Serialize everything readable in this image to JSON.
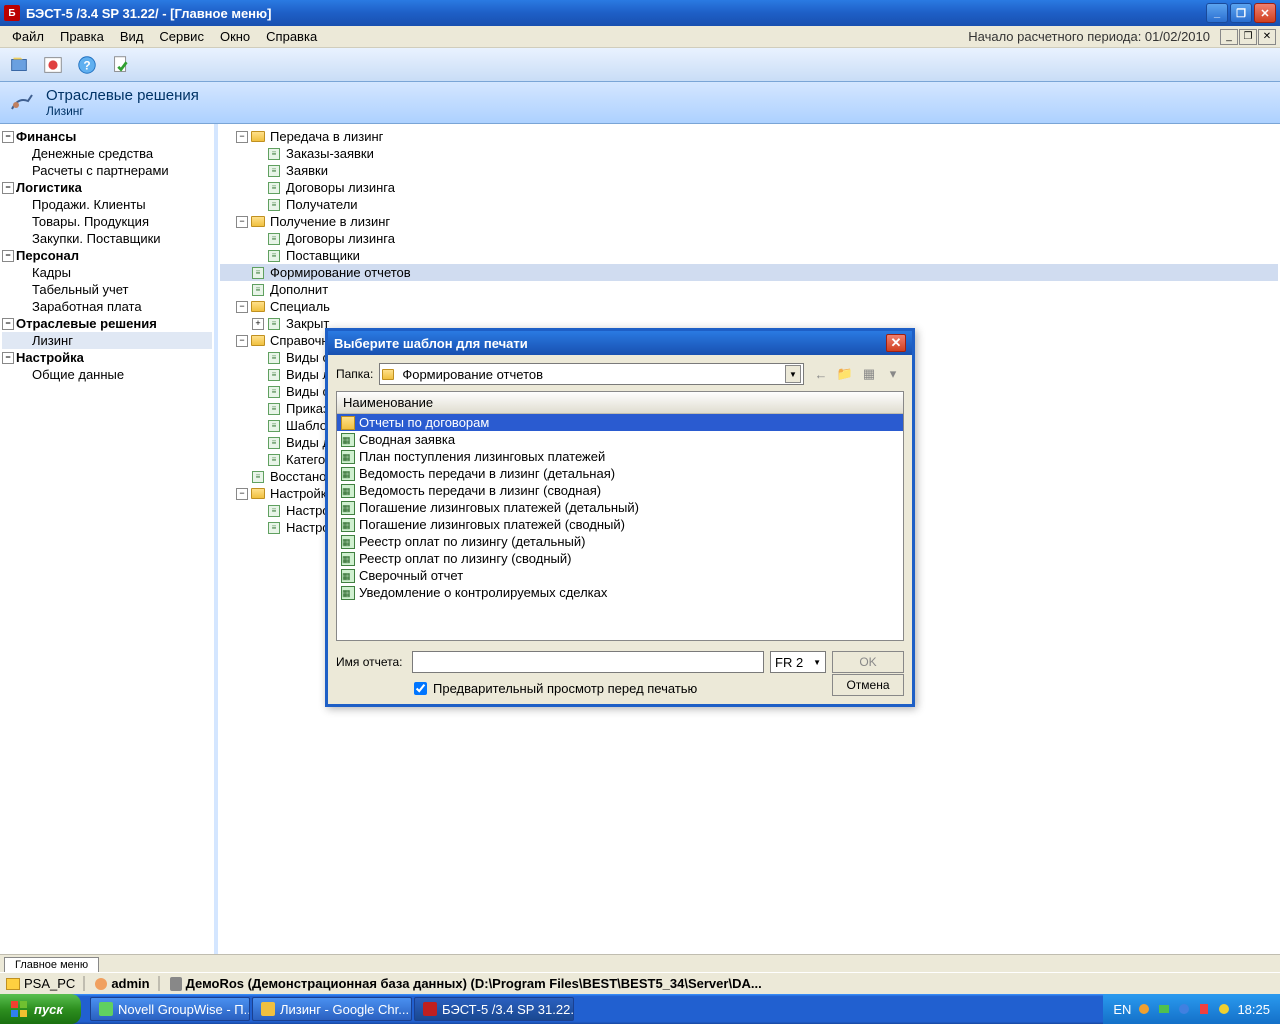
{
  "titlebar": {
    "text": "БЭСТ-5 /3.4 SP 31.22/ - [Главное меню]"
  },
  "menubar": {
    "items": [
      "Файл",
      "Правка",
      "Вид",
      "Сервис",
      "Окно",
      "Справка"
    ],
    "right": "Начало расчетного периода: 01/02/2010"
  },
  "header": {
    "main": "Отраслевые решения",
    "sub": "Лизинг"
  },
  "left_tree": [
    {
      "label": "Финансы",
      "bold": true,
      "exp": "-",
      "indent": 0
    },
    {
      "label": "Денежные средства",
      "indent": 1
    },
    {
      "label": "Расчеты с партнерами",
      "indent": 1
    },
    {
      "label": "Логистика",
      "bold": true,
      "exp": "-",
      "indent": 0
    },
    {
      "label": "Продажи. Клиенты",
      "indent": 1
    },
    {
      "label": "Товары. Продукция",
      "indent": 1
    },
    {
      "label": "Закупки. Поставщики",
      "indent": 1
    },
    {
      "label": "Персонал",
      "bold": true,
      "exp": "-",
      "indent": 0
    },
    {
      "label": "Кадры",
      "indent": 1
    },
    {
      "label": "Табельный учет",
      "indent": 1
    },
    {
      "label": "Заработная плата",
      "indent": 1
    },
    {
      "label": "Отраслевые решения",
      "bold": true,
      "exp": "-",
      "indent": 0
    },
    {
      "label": "Лизинг",
      "indent": 1,
      "selected": true
    },
    {
      "label": "Настройка",
      "bold": true,
      "exp": "-",
      "indent": 0
    },
    {
      "label": "Общие данные",
      "indent": 1
    }
  ],
  "right_tree": [
    {
      "label": "Передача в лизинг",
      "icon": "folder",
      "exp": "-",
      "indent": 0
    },
    {
      "label": "Заказы-заявки",
      "icon": "doc",
      "indent": 1
    },
    {
      "label": "Заявки",
      "icon": "doc",
      "indent": 1
    },
    {
      "label": "Договоры лизинга",
      "icon": "doc",
      "indent": 1
    },
    {
      "label": "Получатели",
      "icon": "doc",
      "indent": 1
    },
    {
      "label": "Получение в лизинг",
      "icon": "folder",
      "exp": "-",
      "indent": 0
    },
    {
      "label": "Договоры лизинга",
      "icon": "doc",
      "indent": 1
    },
    {
      "label": "Поставщики",
      "icon": "doc",
      "indent": 1
    },
    {
      "label": "Формирование отчетов",
      "icon": "doc",
      "indent": 0,
      "hl": true
    },
    {
      "label": "Дополнит",
      "icon": "doc",
      "indent": 0
    },
    {
      "label": "Специаль",
      "icon": "folder",
      "exp": "-",
      "indent": 0
    },
    {
      "label": "Закрыт",
      "icon": "doc",
      "exp": "+",
      "indent": 1
    },
    {
      "label": "Справочн",
      "icon": "folder",
      "exp": "-",
      "indent": 0
    },
    {
      "label": "Виды с",
      "icon": "doc",
      "indent": 1
    },
    {
      "label": "Виды л",
      "icon": "doc",
      "indent": 1
    },
    {
      "label": "Виды с",
      "icon": "doc",
      "indent": 1
    },
    {
      "label": "Приказ",
      "icon": "doc",
      "indent": 1
    },
    {
      "label": "Шабло",
      "icon": "doc",
      "indent": 1
    },
    {
      "label": "Виды д",
      "icon": "doc",
      "indent": 1
    },
    {
      "label": "Катего",
      "icon": "doc",
      "indent": 1
    },
    {
      "label": "Восстано",
      "icon": "doc",
      "indent": 0
    },
    {
      "label": "Настройк",
      "icon": "folder",
      "exp": "-",
      "indent": 0
    },
    {
      "label": "Настро",
      "icon": "doc",
      "indent": 1
    },
    {
      "label": "Настро",
      "icon": "doc",
      "indent": 1
    }
  ],
  "dialog": {
    "title": "Выберите шаблон для печати",
    "folder_label": "Папка:",
    "folder_value": "Формирование отчетов",
    "column_header": "Наименование",
    "items": [
      {
        "name": "Отчеты по договорам",
        "type": "folder",
        "selected": true
      },
      {
        "name": "Сводная заявка",
        "type": "report"
      },
      {
        "name": "План поступления лизинговых платежей",
        "type": "report"
      },
      {
        "name": "Ведомость передачи в лизинг (детальная)",
        "type": "report"
      },
      {
        "name": "Ведомость передачи в лизинг (сводная)",
        "type": "report"
      },
      {
        "name": "Погашение лизинговых платежей (детальный)",
        "type": "report"
      },
      {
        "name": "Погашение лизинговых платежей (сводный)",
        "type": "report"
      },
      {
        "name": "Реестр оплат по лизингу (детальный)",
        "type": "report"
      },
      {
        "name": "Реестр оплат по лизингу (сводный)",
        "type": "report"
      },
      {
        "name": "Сверочный отчет",
        "type": "report"
      },
      {
        "name": "Уведомление о контролируемых сделках",
        "type": "report"
      }
    ],
    "name_label": "Имя отчета:",
    "format": "FR 2",
    "ok": "OK",
    "cancel": "Отмена",
    "preview_label": "Предварительный просмотр перед печатью"
  },
  "bottom_tab": "Главное меню",
  "statusbar": {
    "pc": "PSA_PC",
    "user": "admin",
    "db": "ДемоRos (Демонстрационная база данных) (D:\\Program Files\\BEST\\BEST5_34\\Server\\DA..."
  },
  "taskbar": {
    "start": "пуск",
    "items": [
      {
        "label": "Novell GroupWise - П...",
        "icon": "#60d060"
      },
      {
        "label": "Лизинг - Google Chr...",
        "icon": "#f0c040"
      },
      {
        "label": "БЭСТ-5 /3.4 SP 31.22...",
        "icon": "#c02020",
        "active": true
      }
    ],
    "lang": "EN",
    "time": "18:25"
  }
}
